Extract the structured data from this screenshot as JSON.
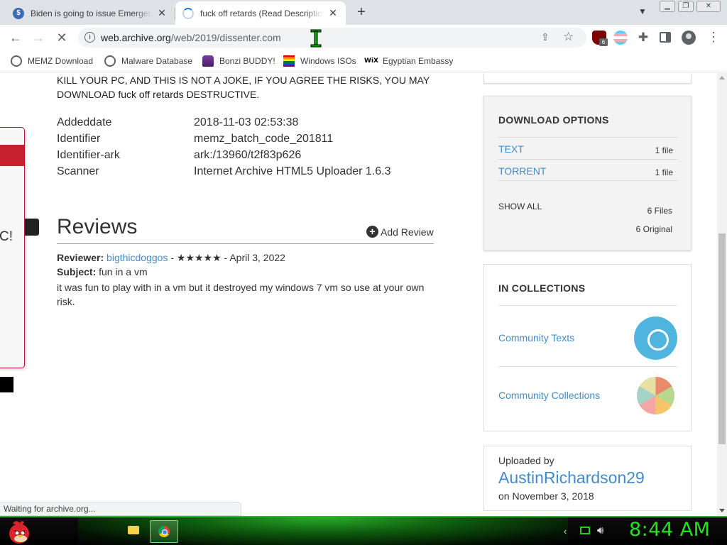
{
  "tabs": [
    {
      "title": "Biden is going to issue Emergency",
      "favicon": "dollar-icon"
    },
    {
      "title": "fuck off retards (Read Description",
      "favicon": "loading-spinner-icon"
    }
  ],
  "toolbar": {
    "url_host": "web.archive.org",
    "url_path": "/web/2019/dissenter.com"
  },
  "bookmarks": [
    {
      "label": "MEMZ Download",
      "icon": "globe-icon"
    },
    {
      "label": "Malware Database",
      "icon": "globe-icon"
    },
    {
      "label": "Bonzi BUDDY!",
      "icon": "bonzi-icon"
    },
    {
      "label": "Windows ISOs",
      "icon": "rainbow-flag-icon"
    },
    {
      "label": "Egyptian Embassy",
      "icon": "wix-icon"
    }
  ],
  "extensions": {
    "ublock_badge": "6"
  },
  "item": {
    "description": "KILL YOUR PC, AND THIS IS NOT A JOKE, IF YOU AGREE THE RISKS, YOU MAY DOWNLOAD fuck off retards DESTRUCTIVE.",
    "metadata": [
      {
        "key": "Addeddate",
        "value": "2018-11-03 02:53:38"
      },
      {
        "key": "Identifier",
        "value": "memz_batch_code_201811"
      },
      {
        "key": "Identifier-ark",
        "value": "ark:/13960/t2f83p626"
      },
      {
        "key": "Scanner",
        "value": "Internet Archive HTML5 Uploader 1.6.3"
      }
    ]
  },
  "popup": {
    "glyph": "C!"
  },
  "reviews": {
    "heading": "Reviews",
    "add_label": "Add Review",
    "items": [
      {
        "reviewer_label": "Reviewer:",
        "reviewer": "bigthicdoggos",
        "rating_date": "- ★★★★★ - April 3, 2022",
        "subject_label": "Subject:",
        "subject": "fun in a vm",
        "body": "it was fun to play with in a vm but it destroyed my windows 7 vm so use at your own risk."
      }
    ]
  },
  "download_options": {
    "heading": "DOWNLOAD OPTIONS",
    "formats": [
      {
        "label": "TEXT",
        "count": "1 file"
      },
      {
        "label": "TORRENT",
        "count": "1 file"
      }
    ],
    "show_all": "SHOW ALL",
    "files": "6 Files",
    "original": "6 Original"
  },
  "collections": {
    "heading": "IN COLLECTIONS",
    "items": [
      {
        "label": "Community Texts",
        "icon": "community-texts-icon"
      },
      {
        "label": "Community Collections",
        "icon": "community-collections-icon"
      }
    ]
  },
  "uploader": {
    "label": "Uploaded by",
    "name": "AustinRichardson29",
    "date": "on November 3, 2018"
  },
  "status": "Waiting for archive.org...",
  "taskbar": {
    "clock": "8:44 AM"
  },
  "colors": {
    "link": "#428bca",
    "taskbar_accent": "#23e223",
    "popup_red": "#c7202f"
  }
}
